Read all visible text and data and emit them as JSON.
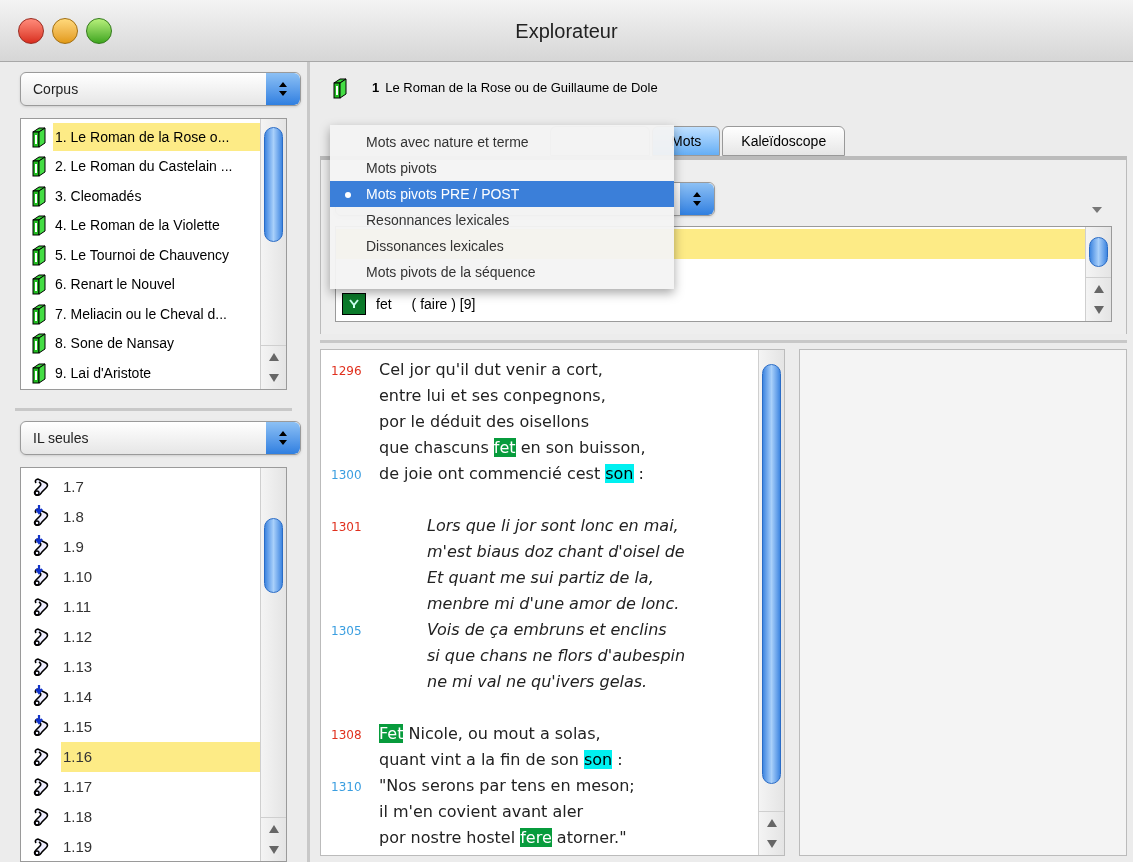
{
  "window": {
    "title": "Explorateur"
  },
  "corpus": {
    "popup": "Corpus",
    "items": [
      {
        "label": "1. Le Roman de la Rose o...",
        "selected": true
      },
      {
        "label": "2. Le Roman du Castelain ...",
        "selected": false
      },
      {
        "label": "3. Cleomadés",
        "selected": false
      },
      {
        "label": "4. Le Roman de la Violette",
        "selected": false
      },
      {
        "label": "5. Le Tournoi de Chauvency",
        "selected": false
      },
      {
        "label": "6. Renart le Nouvel",
        "selected": false
      },
      {
        "label": "7. Meliacin ou le Cheval d...",
        "selected": false
      },
      {
        "label": "8. Sone de Nansay",
        "selected": false
      },
      {
        "label": "9. Lai d'Aristote",
        "selected": false
      }
    ]
  },
  "units": {
    "popup": "IL seules",
    "items": [
      {
        "label": "1.7",
        "kind": "plain",
        "selected": false
      },
      {
        "label": "1.8",
        "kind": "marked",
        "selected": false
      },
      {
        "label": "1.9",
        "kind": "marked",
        "selected": false
      },
      {
        "label": "1.10",
        "kind": "marked",
        "selected": false
      },
      {
        "label": "1.11",
        "kind": "plain",
        "selected": false
      },
      {
        "label": "1.12",
        "kind": "plain",
        "selected": false
      },
      {
        "label": "1.13",
        "kind": "plain",
        "selected": false
      },
      {
        "label": "1.14",
        "kind": "marked",
        "selected": false
      },
      {
        "label": "1.15",
        "kind": "marked",
        "selected": false
      },
      {
        "label": "1.16",
        "kind": "plain",
        "selected": true
      },
      {
        "label": "1.17",
        "kind": "plain",
        "selected": false
      },
      {
        "label": "1.18",
        "kind": "plain",
        "selected": false
      },
      {
        "label": "1.19",
        "kind": "plain",
        "selected": false
      }
    ]
  },
  "header": {
    "number": "1",
    "title": "Le Roman de la Rose ou de Guillaume de Dole"
  },
  "tabs": [
    {
      "label": "Mots",
      "selected": true
    },
    {
      "label": "Kaleïdoscope",
      "selected": false
    }
  ],
  "menu": {
    "items": [
      {
        "label": "Mots avec nature et terme",
        "selected": false
      },
      {
        "label": "Mots pivots",
        "selected": false
      },
      {
        "label": "Mots pivots PRE / POST",
        "selected": true
      },
      {
        "label": "Resonnances lexicales",
        "selected": false
      },
      {
        "label": "Dissonances lexicales",
        "selected": false
      },
      {
        "label": "Mots pivots de la séquence",
        "selected": false
      }
    ]
  },
  "word_list": {
    "rows": [
      {
        "selected": true
      },
      {
        "selected": false
      },
      {
        "word": "fet",
        "note": "( faire ) [9]",
        "selected": false
      }
    ]
  },
  "text": {
    "stanzas": [
      {
        "italic": false,
        "lines": [
          {
            "number": "1296",
            "color": "#e0301e",
            "parts": [
              {
                "text": "Cel jor qu'il dut venir a cort,",
                "kind": "plain"
              }
            ]
          },
          {
            "parts": [
              {
                "text": "entre lui et ses conpegnons,",
                "kind": "plain"
              }
            ]
          },
          {
            "parts": [
              {
                "text": "por le déduit des oisellons",
                "kind": "plain"
              }
            ]
          },
          {
            "parts": [
              {
                "text": "que chascuns ",
                "kind": "plain"
              },
              {
                "text": "fet",
                "kind": "pivot"
              },
              {
                "text": " en son buisson,",
                "kind": "plain"
              }
            ]
          },
          {
            "number": "1300",
            "color": "#3a9ee0",
            "parts": [
              {
                "text": "de joie ont commencié cest ",
                "kind": "plain"
              },
              {
                "text": "son",
                "kind": "echo"
              },
              {
                "text": " :",
                "kind": "plain"
              }
            ]
          }
        ]
      },
      {
        "italic": true,
        "lines": [
          {
            "number": "1301",
            "color": "#e0301e",
            "parts": [
              {
                "text": "Lors que li jor sont lonc en mai,",
                "kind": "plain"
              }
            ]
          },
          {
            "parts": [
              {
                "text": "m'est biaus doz chant d'oisel de",
                "kind": "plain"
              }
            ]
          },
          {
            "parts": [
              {
                "text": "Et quant me sui partiz de la,",
                "kind": "plain"
              }
            ]
          },
          {
            "parts": [
              {
                "text": "menbre mi d'une amor de lonc.",
                "kind": "plain"
              }
            ]
          },
          {
            "number": "1305",
            "color": "#3a9ee0",
            "parts": [
              {
                "text": "Vois de ça embruns et enclins",
                "kind": "plain"
              }
            ]
          },
          {
            "parts": [
              {
                "text": "si que chans ne flors d'aubespin",
                "kind": "plain"
              }
            ]
          },
          {
            "parts": [
              {
                "text": "ne mi val ne qu'ivers gelas.",
                "kind": "plain"
              }
            ]
          }
        ]
      },
      {
        "italic": false,
        "lines": [
          {
            "number": "1308",
            "color": "#e0301e",
            "parts": [
              {
                "text": "Fet",
                "kind": "pivot"
              },
              {
                "text": " Nicole, ou mout a solas,",
                "kind": "plain"
              }
            ]
          },
          {
            "parts": [
              {
                "text": "quant vint a la fin de son ",
                "kind": "plain"
              },
              {
                "text": "son",
                "kind": "echo"
              },
              {
                "text": " :",
                "kind": "plain"
              }
            ]
          },
          {
            "number": "1310",
            "color": "#3a9ee0",
            "parts": [
              {
                "text": "\"Nos serons par tens en meson;",
                "kind": "plain"
              }
            ]
          },
          {
            "parts": [
              {
                "text": "il m'en covient avant aler",
                "kind": "plain"
              }
            ]
          },
          {
            "parts": [
              {
                "text": "por nostre hostel ",
                "kind": "plain"
              },
              {
                "text": "fere",
                "kind": "pivot"
              },
              {
                "text": " atorner.\"",
                "kind": "plain"
              }
            ]
          }
        ]
      }
    ]
  }
}
